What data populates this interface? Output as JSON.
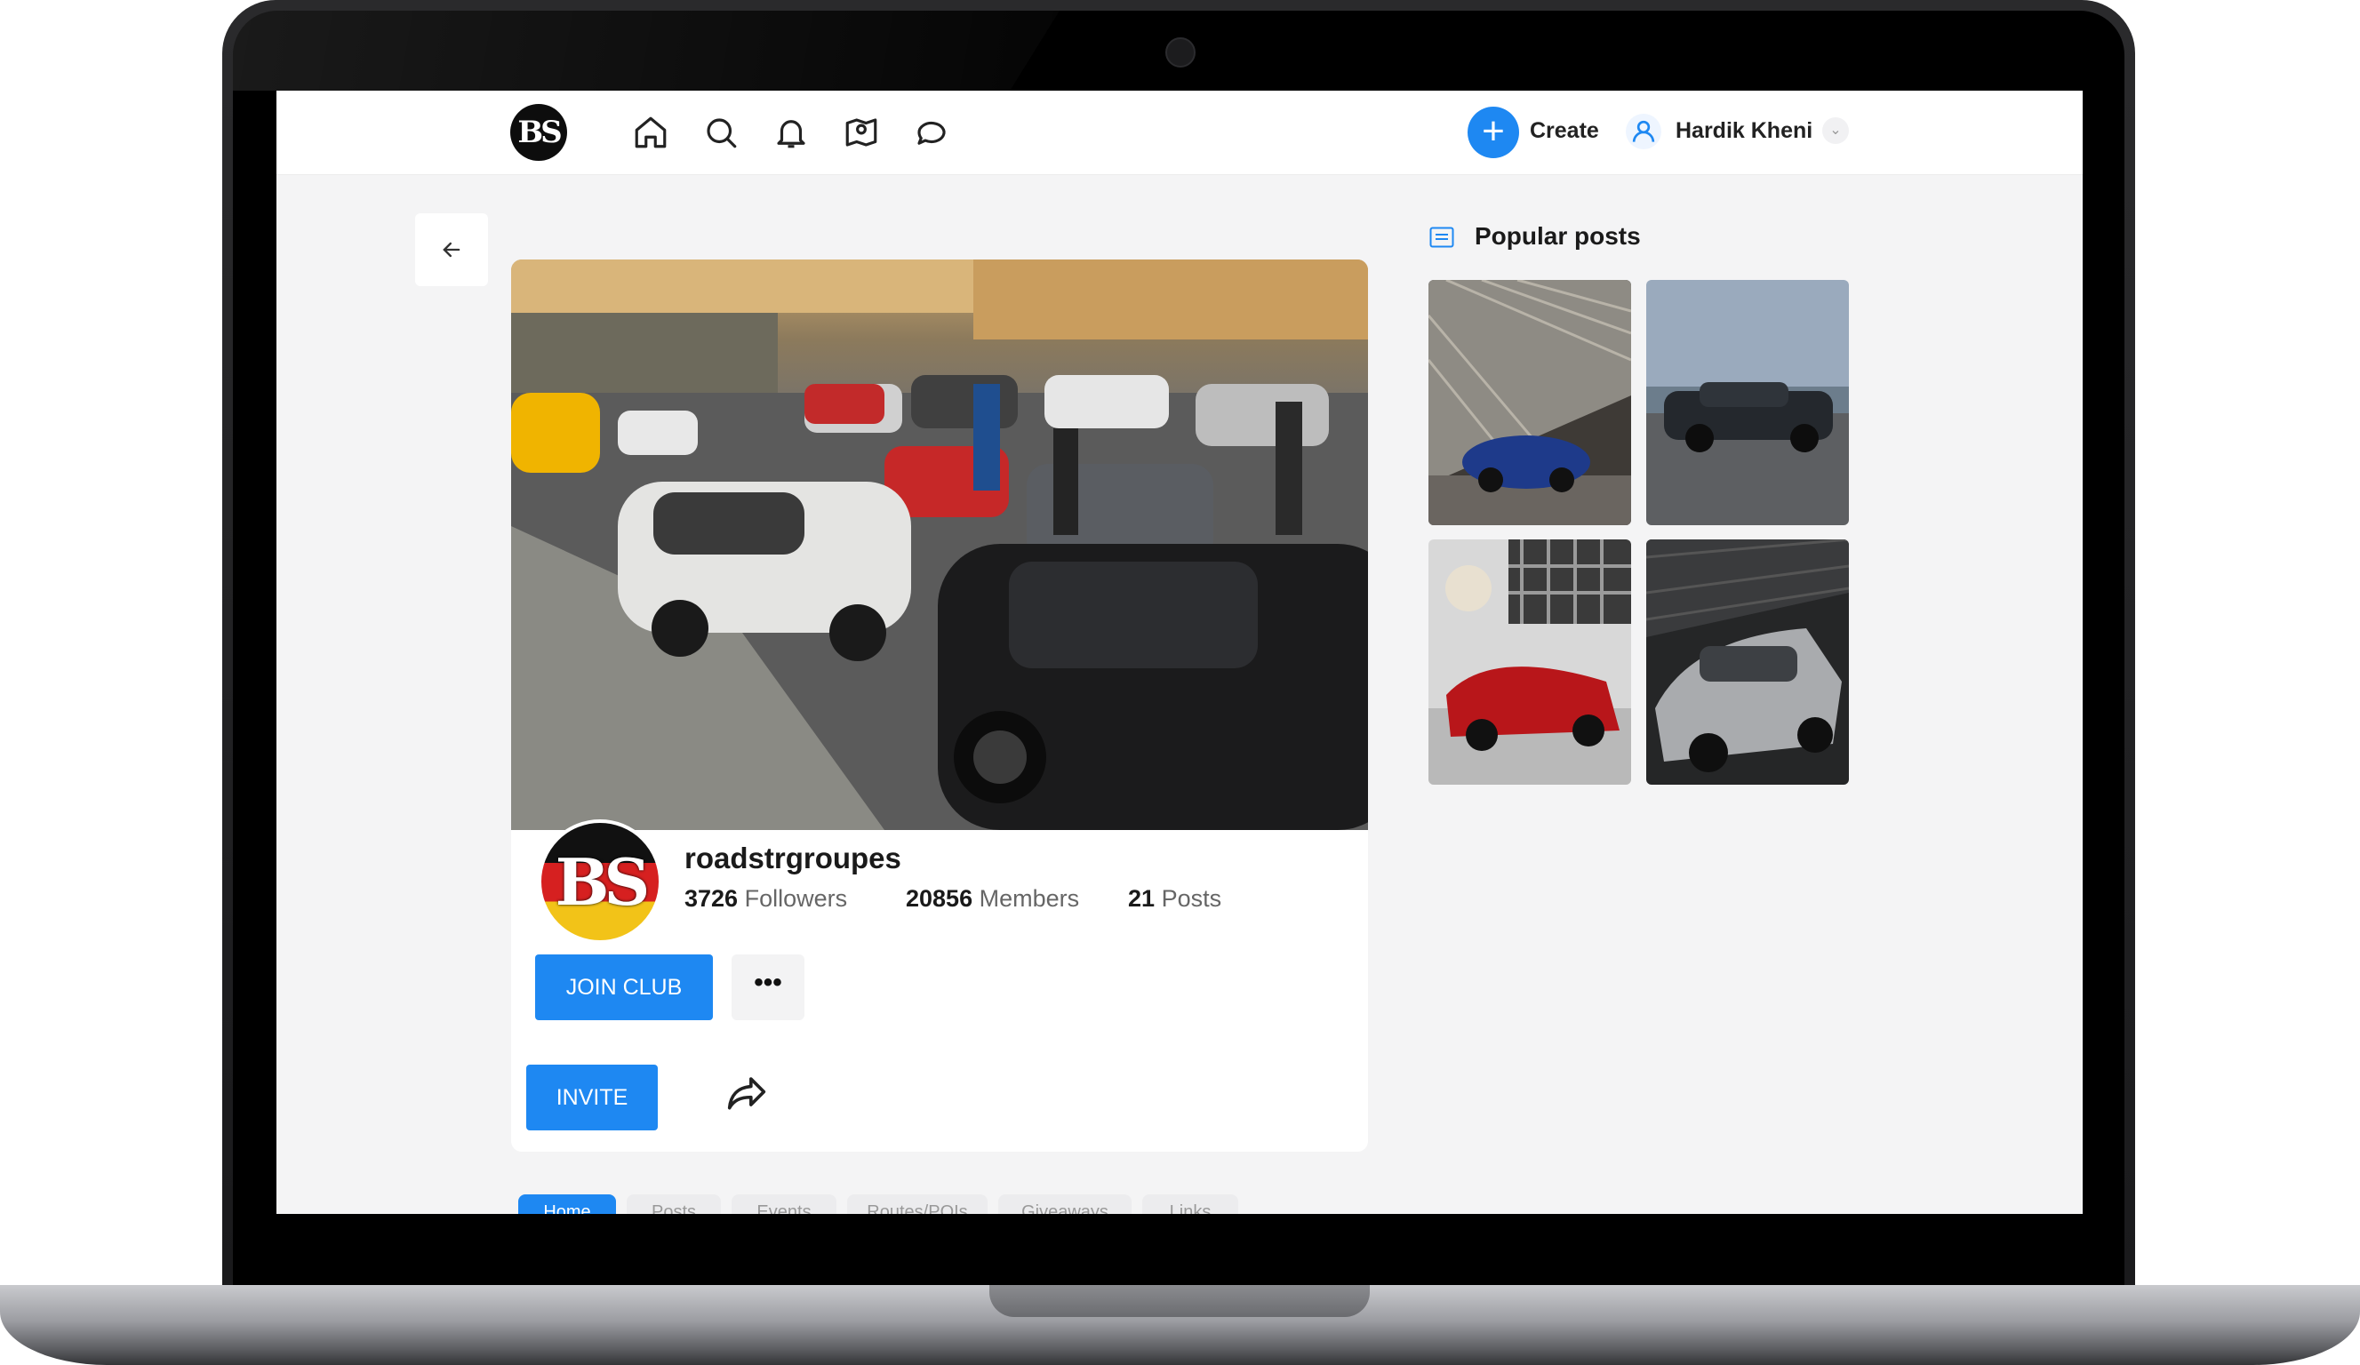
{
  "nav": {
    "icons": [
      "logo",
      "home-icon",
      "search-icon",
      "bell-icon",
      "map-icon",
      "chat-icon"
    ],
    "logo_text": "BS",
    "create_label": "Create",
    "user_name": "Hardik Kheni"
  },
  "club": {
    "name": "roadstrgroupes",
    "followers_count": "3726",
    "followers_label": "Followers",
    "members_count": "20856",
    "members_label": "Members",
    "posts_count": "21",
    "posts_label": "Posts",
    "join_label": "JOIN CLUB",
    "more_label": "•••",
    "invite_label": "INVITE",
    "logo_text": "BS"
  },
  "tabs": [
    {
      "label": "Home",
      "active": true
    },
    {
      "label": "Posts"
    },
    {
      "label": "Events"
    },
    {
      "label": "Routes/POIs"
    },
    {
      "label": "Giveaways"
    },
    {
      "label": "Links"
    }
  ],
  "sidebar": {
    "title": "Popular posts"
  },
  "colors": {
    "accent": "#1e88f2",
    "background": "#f4f4f5",
    "card": "#ffffff"
  }
}
